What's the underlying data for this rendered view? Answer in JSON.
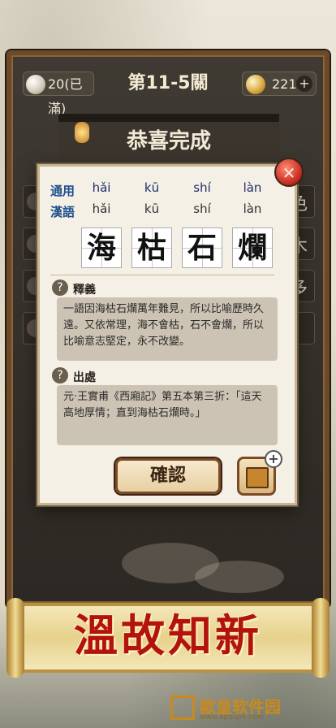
{
  "topbar": {
    "energy": "20(已滿)",
    "level": "第11-5關",
    "coins": "221",
    "plus": "+"
  },
  "banner": {
    "title": "恭喜完成"
  },
  "side_rows": [
    {
      "char": "色"
    },
    {
      "char": "木"
    },
    {
      "char": "多"
    },
    {
      "char": ""
    }
  ],
  "dialog": {
    "close": "✕",
    "tags": [
      "通用",
      "漢語"
    ],
    "pinyin_general": [
      "hǎi",
      "kū",
      "shí",
      "làn"
    ],
    "pinyin_hanyu": [
      "hǎi",
      "kū",
      "shí",
      "làn"
    ],
    "chars": [
      "海",
      "枯",
      "石",
      "爛"
    ],
    "meaning_title": "釋義",
    "meaning_text": "一語因海枯石爛萬年難見，所以比喻歷時久遠。又依常理，海不會枯，石不會爛，所以比喻意志堅定，永不改變。",
    "source_title": "出處",
    "source_text": "元·王實甫《西廂記》第五本第三折：「這天高地厚情；直到海枯石爛時。」",
    "q_mark": "?",
    "confirm": "確認",
    "book_plus": "+"
  },
  "scroll": {
    "title": "溫故知新"
  },
  "watermark": {
    "name": "歐皇软件园",
    "url": "www.apoujin.com"
  }
}
